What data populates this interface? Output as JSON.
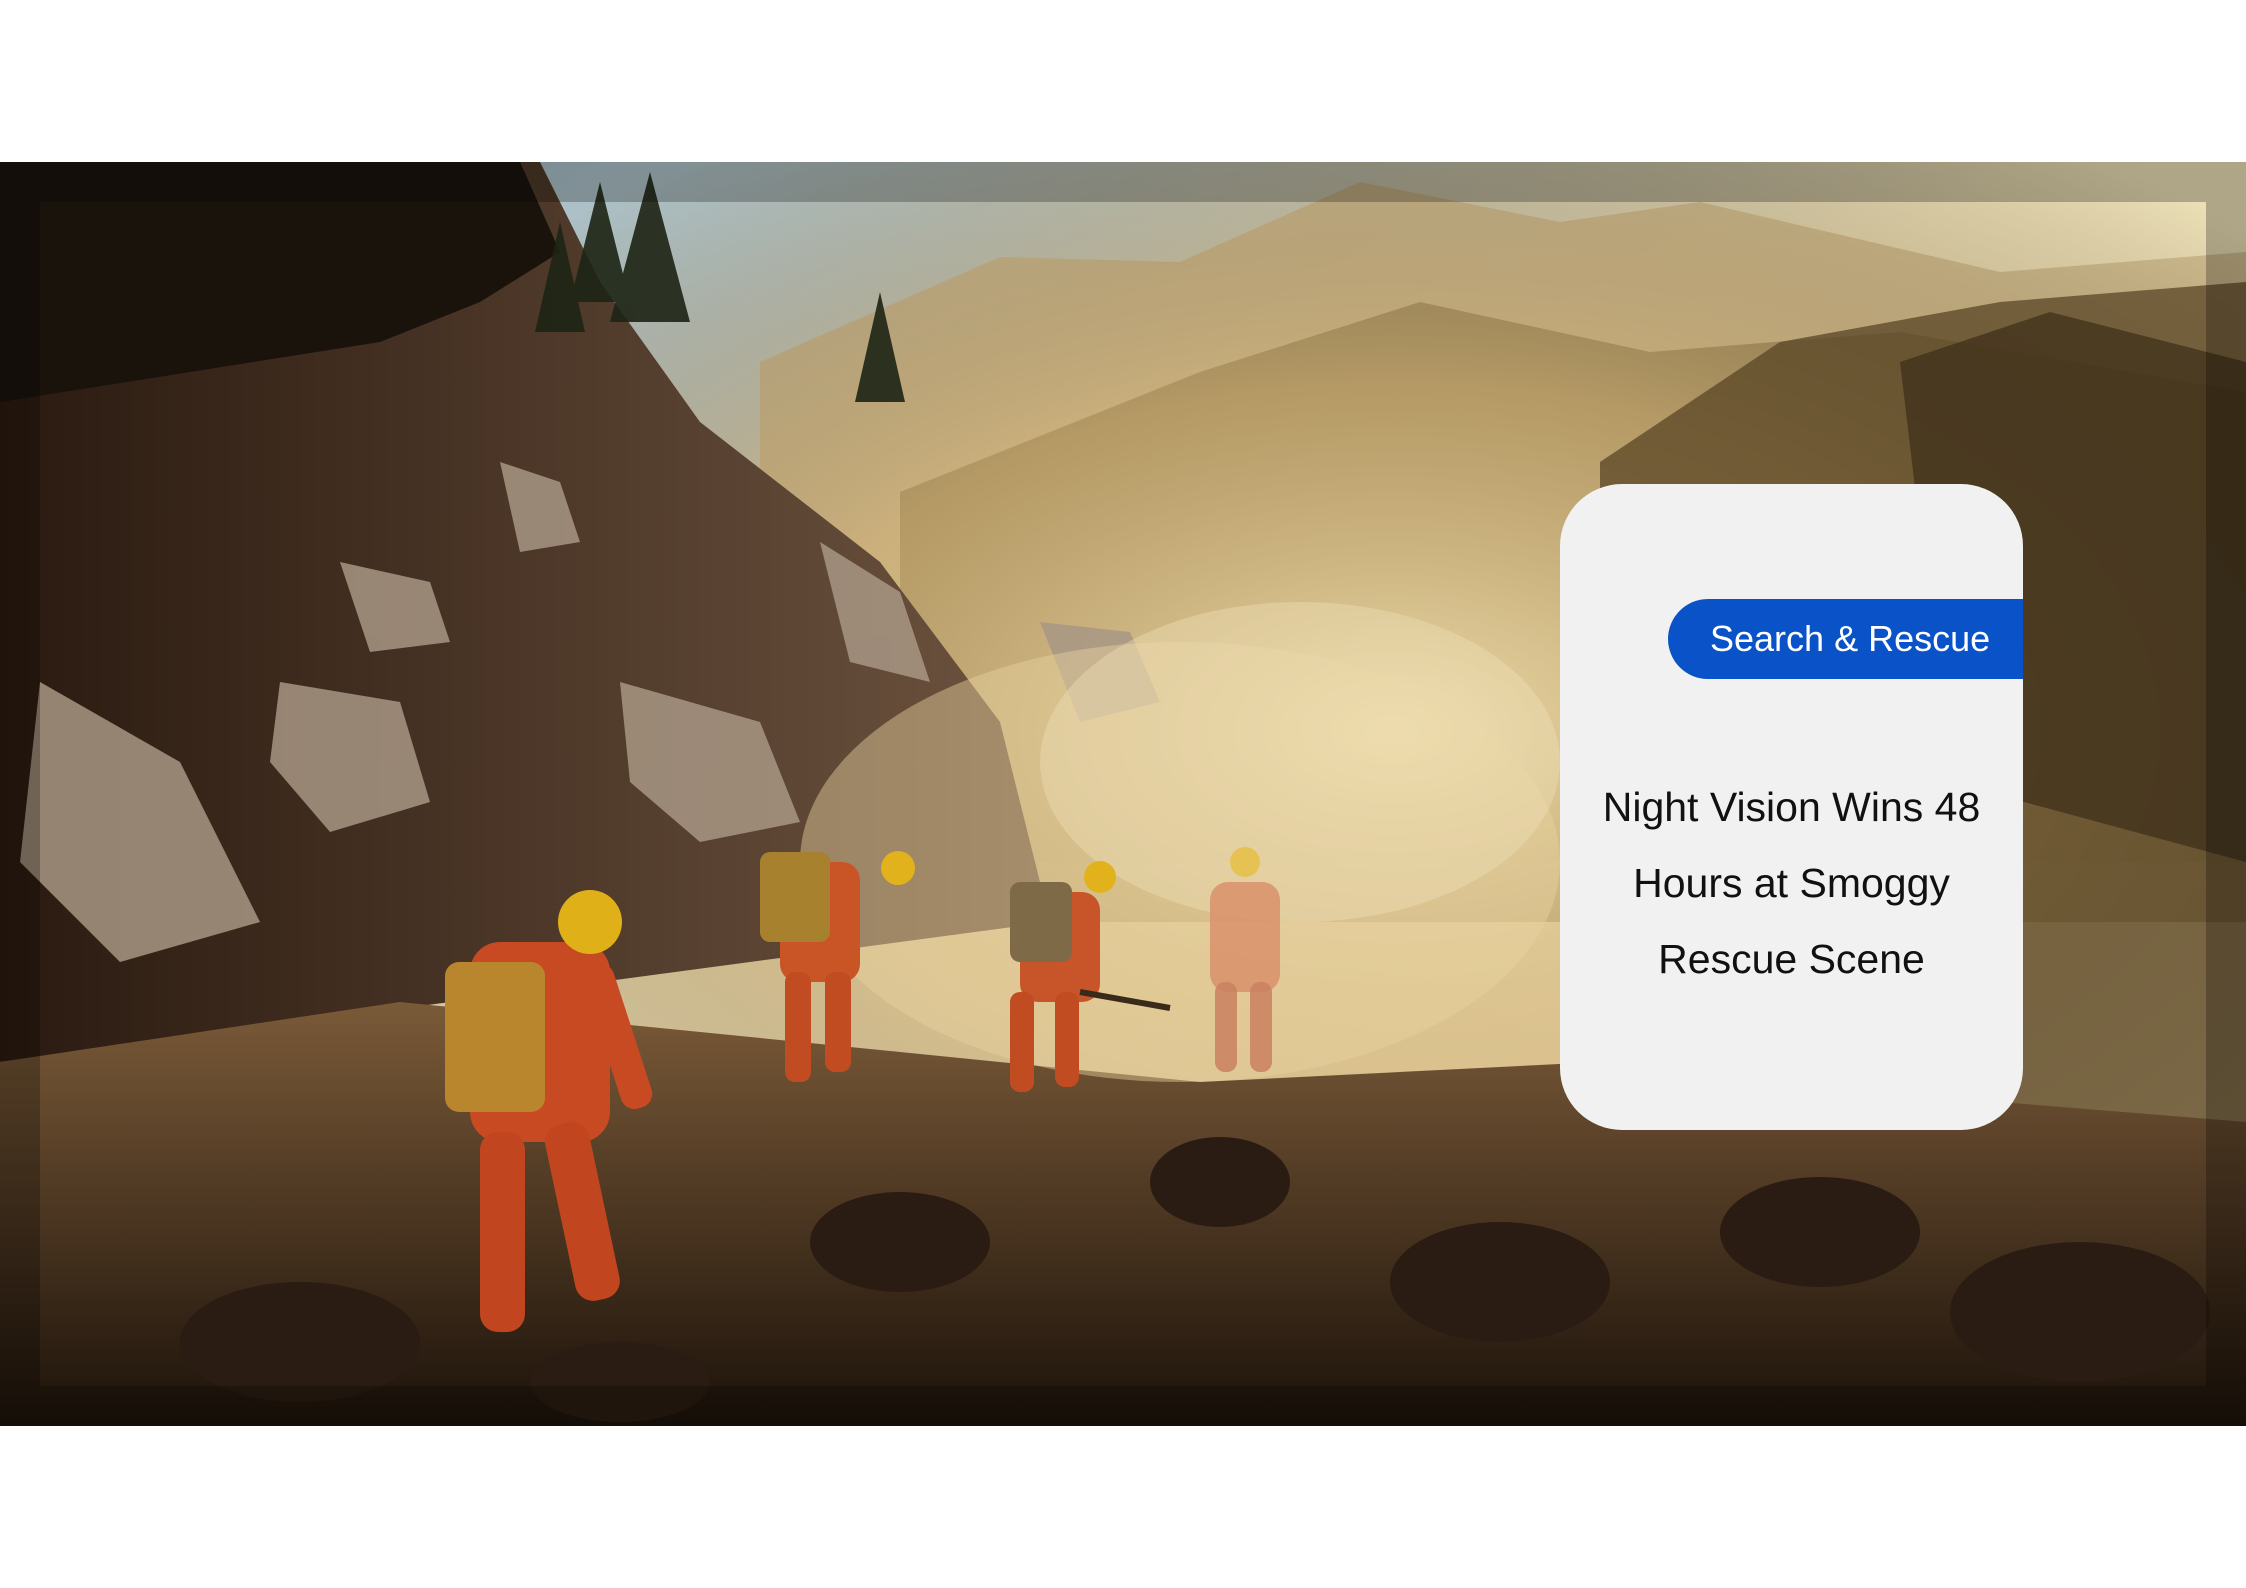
{
  "photo": {
    "subject": "rescue-team-on-rocky-mountain-slope"
  },
  "card": {
    "tag_label": "Search & Rescue",
    "headline_lines": [
      "Night Vision Wins 48",
      "Hours at Smoggy",
      "Rescue Scene"
    ],
    "tag_color": "#0a52c8",
    "card_color": "#f1f1f1"
  }
}
